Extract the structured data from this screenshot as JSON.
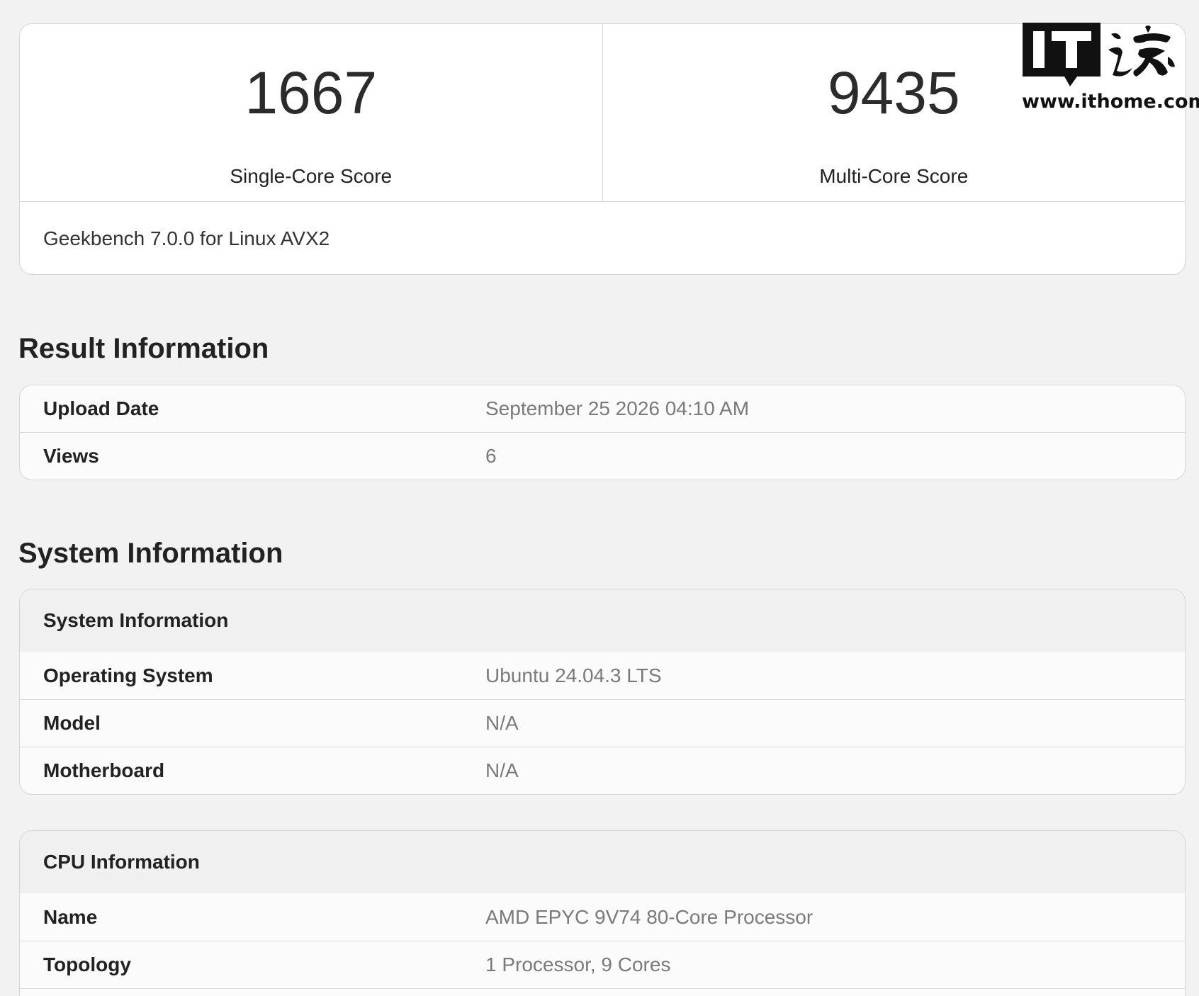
{
  "scores": {
    "single_core_value": "1667",
    "single_core_label": "Single-Core Score",
    "multi_core_value": "9435",
    "multi_core_label": "Multi-Core Score",
    "version": "Geekbench 7.0.0 for Linux AVX2"
  },
  "watermark": {
    "logo_text": "IT之家",
    "url": "www.ithome.com"
  },
  "result_information": {
    "title": "Result Information",
    "rows": [
      {
        "key": "Upload Date",
        "value": "September 25 2026 04:10 AM"
      },
      {
        "key": "Views",
        "value": "6"
      }
    ]
  },
  "system_information": {
    "title": "System Information",
    "system_table": {
      "heading": "System Information",
      "rows": [
        {
          "key": "Operating System",
          "value": "Ubuntu 24.04.3 LTS"
        },
        {
          "key": "Model",
          "value": "N/A"
        },
        {
          "key": "Motherboard",
          "value": "N/A"
        }
      ]
    },
    "cpu_table": {
      "heading": "CPU Information",
      "rows": [
        {
          "key": "Name",
          "value": "AMD EPYC 9V74 80-Core Processor"
        },
        {
          "key": "Topology",
          "value": "1 Processor, 9 Cores"
        }
      ]
    }
  }
}
